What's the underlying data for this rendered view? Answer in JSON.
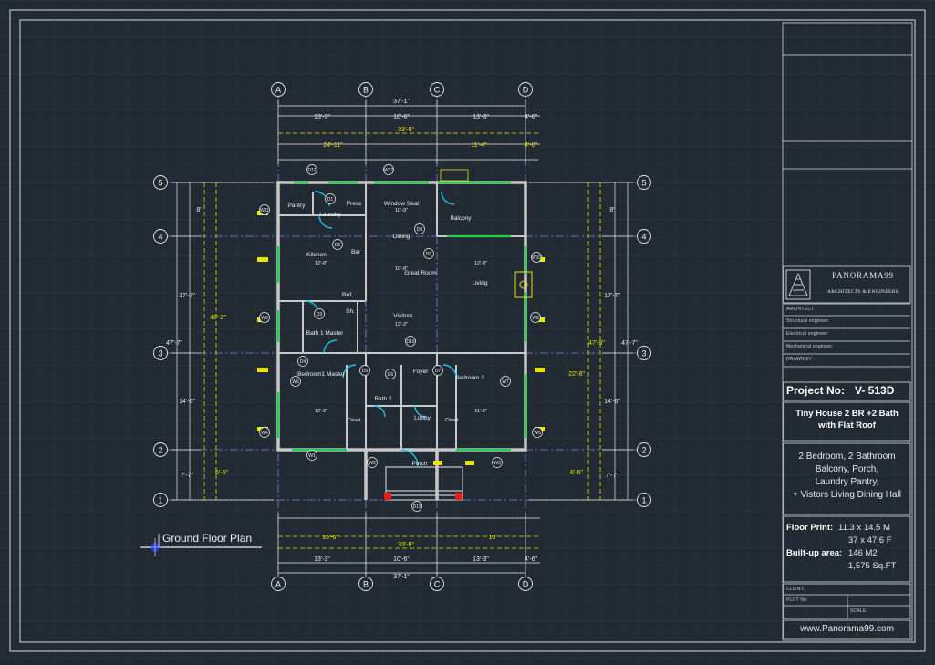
{
  "drawing": {
    "title": "Ground Floor Plan",
    "grid_cols": [
      "A",
      "B",
      "C",
      "D"
    ],
    "grid_rows": [
      "5",
      "4",
      "3",
      "2",
      "1"
    ],
    "dims_top": {
      "overall": "37'-1\"",
      "parts": [
        "13'-3\"",
        "10'-6\"",
        "13'-3\"",
        "4'-6\""
      ],
      "second": "33'-9\"",
      "third": [
        "24'-11\"",
        "11'-4\"",
        "4'-6\""
      ]
    },
    "dims_bottom": {
      "overall": "37'-1\"",
      "parts": [
        "13'-3\"",
        "10'-6\"",
        "13'-3\"",
        "4'-6\""
      ],
      "second": "33'-9\"",
      "third": [
        "15'-6\"",
        "10'"
      ]
    },
    "dims_left": {
      "overall": "47'-7\"",
      "parts": [
        "17'-7\"",
        "14'-6\"",
        "7'-7\""
      ],
      "inner": [
        "40'-2\"",
        "6'-6\"",
        "8'"
      ]
    },
    "dims_right": {
      "overall": "47'-7\"",
      "parts": [
        "17'-7\"",
        "14'-6\"",
        "7'-7\""
      ],
      "inner": [
        "47'-9\"",
        "22'-8\"",
        "6'-6\"",
        "8'"
      ]
    },
    "rooms": [
      "Pantry",
      "Laundry",
      "Press",
      "Window Seat",
      "Balcony",
      "Kitchen",
      "Dining",
      "Bar",
      "Great Room",
      "Living",
      "Ref.",
      "Sh.",
      "Visitors",
      "Bath 1 Master",
      "Bedroom1 Master",
      "Foyer",
      "Bath 2",
      "Bedroom 2",
      "Lobby",
      "Closet",
      "Closet",
      "Porch"
    ],
    "room_dims": [
      "12'-8\"",
      "10'-9\"",
      "12'-8\"",
      "13'-2\"",
      "12'-2\"",
      "11'-8\"",
      "10'-8\""
    ],
    "tags": [
      "W1",
      "W2",
      "W3",
      "W4",
      "W5",
      "W6",
      "W7",
      "W8",
      "W9",
      "W10",
      "W11",
      "W12",
      "D1",
      "D2",
      "D3",
      "D4",
      "D5",
      "D6",
      "D7",
      "D8",
      "D9",
      "D10",
      "D11",
      "D12"
    ]
  },
  "titleblock": {
    "company": "PANORAMA99",
    "company_sub": "ARCHITECTS & ENGINEERS",
    "rows": [
      "ARCHITECT :",
      "Structural engineer:",
      "Electrical engineer:",
      "Mechanical engineer:",
      "DRAWN BY :"
    ],
    "project_label": "Project No:",
    "project_no": "V- 513D",
    "house_title_1": "Tiny House 2 BR +2 Bath",
    "house_title_2": "with Flat Roof",
    "desc_1": "2 Bedroom, 2 Bathroom",
    "desc_2": "Balcony, Porch,",
    "desc_3": "Laundry Pantry,",
    "desc_4": "+ Vistors Living Dining Hall",
    "floor_print_label": "Floor Print:",
    "floor_print_1": "11.3 x 14.5 M",
    "floor_print_2": "37 x 47.6 F",
    "builtup_label": "Built-up area:",
    "builtup_1": "146 M2",
    "builtup_2": "1,575 Sq.FT",
    "client_label": "CLIENT:",
    "plot_label": "PLOT No:",
    "scale_label": "SCALE:",
    "website": "www.Panorama99.com"
  },
  "colors": {
    "background": "#222b34",
    "wall": "#c8c8c8",
    "grid": "#8b7fd6",
    "dim_yellow": "#e6e600",
    "window_green": "#22d14a",
    "door_cyan": "#19c6e6",
    "marker_red": "#e02020",
    "text_white": "#f0f0f0"
  }
}
